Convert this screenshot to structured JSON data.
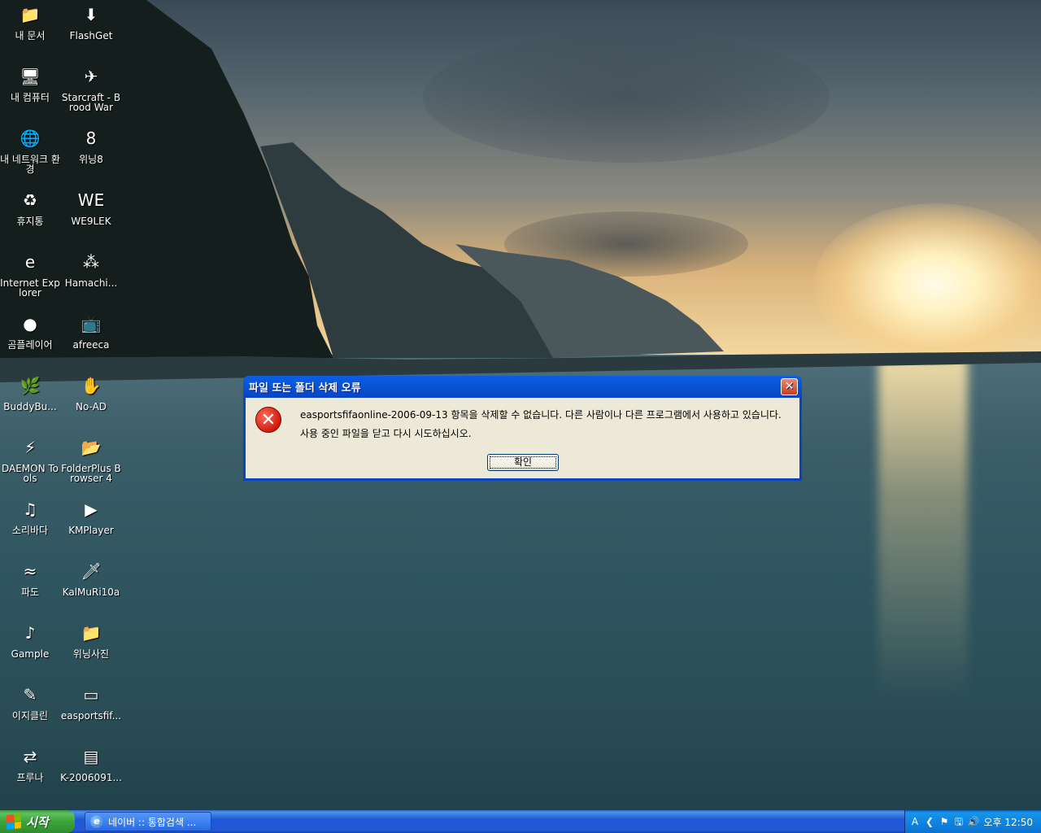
{
  "desktop": {
    "icons": [
      {
        "label": "내 문서",
        "glyph": "📁",
        "name": "my-documents-icon"
      },
      {
        "label": "FlashGet",
        "glyph": "⬇",
        "name": "flashget-icon"
      },
      {
        "label": "내 컴퓨터",
        "glyph": "🖥",
        "name": "my-computer-icon"
      },
      {
        "label": "Starcraft - Brood War",
        "glyph": "✈",
        "name": "starcraft-icon"
      },
      {
        "label": "내 네트워크 환경",
        "glyph": "🌐",
        "name": "network-places-icon"
      },
      {
        "label": "위닝8",
        "glyph": "8",
        "name": "winning8-icon"
      },
      {
        "label": "휴지통",
        "glyph": "♻",
        "name": "recycle-bin-icon"
      },
      {
        "label": "WE9LEK",
        "glyph": "WE",
        "name": "we9lek-icon"
      },
      {
        "label": "Internet Explorer",
        "glyph": "e",
        "name": "internet-explorer-icon"
      },
      {
        "label": "Hamachi...",
        "glyph": "⁂",
        "name": "hamachi-icon"
      },
      {
        "label": "곰플레이어",
        "glyph": "●",
        "name": "gom-player-icon"
      },
      {
        "label": "afreeca",
        "glyph": "📺",
        "name": "afreeca-icon"
      },
      {
        "label": "BuddyBu...",
        "glyph": "🌿",
        "name": "buddybuddy-icon"
      },
      {
        "label": "No-AD",
        "glyph": "✋",
        "name": "no-ad-icon"
      },
      {
        "label": "DAEMON Tools",
        "glyph": "⚡",
        "name": "daemon-tools-icon"
      },
      {
        "label": "FolderPlus Browser 4",
        "glyph": "📂",
        "name": "folderplus-icon"
      },
      {
        "label": "소리바다",
        "glyph": "♫",
        "name": "soribada-icon"
      },
      {
        "label": "KMPlayer",
        "glyph": "▶",
        "name": "kmplayer-icon"
      },
      {
        "label": "파도",
        "glyph": "≈",
        "name": "pado-icon"
      },
      {
        "label": "KalMuRi10a",
        "glyph": "🗡",
        "name": "kalmuri-icon"
      },
      {
        "label": "Gample",
        "glyph": "♪",
        "name": "gample-icon"
      },
      {
        "label": "위닝사진",
        "glyph": "📁",
        "name": "winning-photos-folder-icon"
      },
      {
        "label": "이지클린",
        "glyph": "✎",
        "name": "easyclean-icon"
      },
      {
        "label": "easportsfif...",
        "glyph": "▭",
        "name": "easportsfifa-icon"
      },
      {
        "label": "프루나",
        "glyph": "⇄",
        "name": "pruna-icon"
      },
      {
        "label": "K-2006091...",
        "glyph": "▤",
        "name": "k2006-file-icon"
      }
    ]
  },
  "dialog": {
    "title": "파일 또는 폴더 삭제 오류",
    "message_line1": "easportsfifaonline-2006-09-13 항목을 삭제할 수 없습니다. 다른 사람이나 다른 프로그램에서 사용하고 있습니다.",
    "message_line2": "사용 중인 파일을 닫고 다시 시도하십시오.",
    "ok_label": "확인",
    "close_glyph": "✕",
    "icon": "error-icon"
  },
  "taskbar": {
    "start_label": "시작",
    "task_item_label": "네이버 :: 통합검색 ...",
    "tray": {
      "items": [
        "A",
        "❮",
        "⚑",
        "🖫",
        "🔊"
      ],
      "clock": "오후 12:50"
    }
  },
  "colors": {
    "titlebar": "#0845c6",
    "dialog_face": "#ece9d8",
    "taskbar": "#2157d7",
    "start_green": "#3aa53a"
  }
}
